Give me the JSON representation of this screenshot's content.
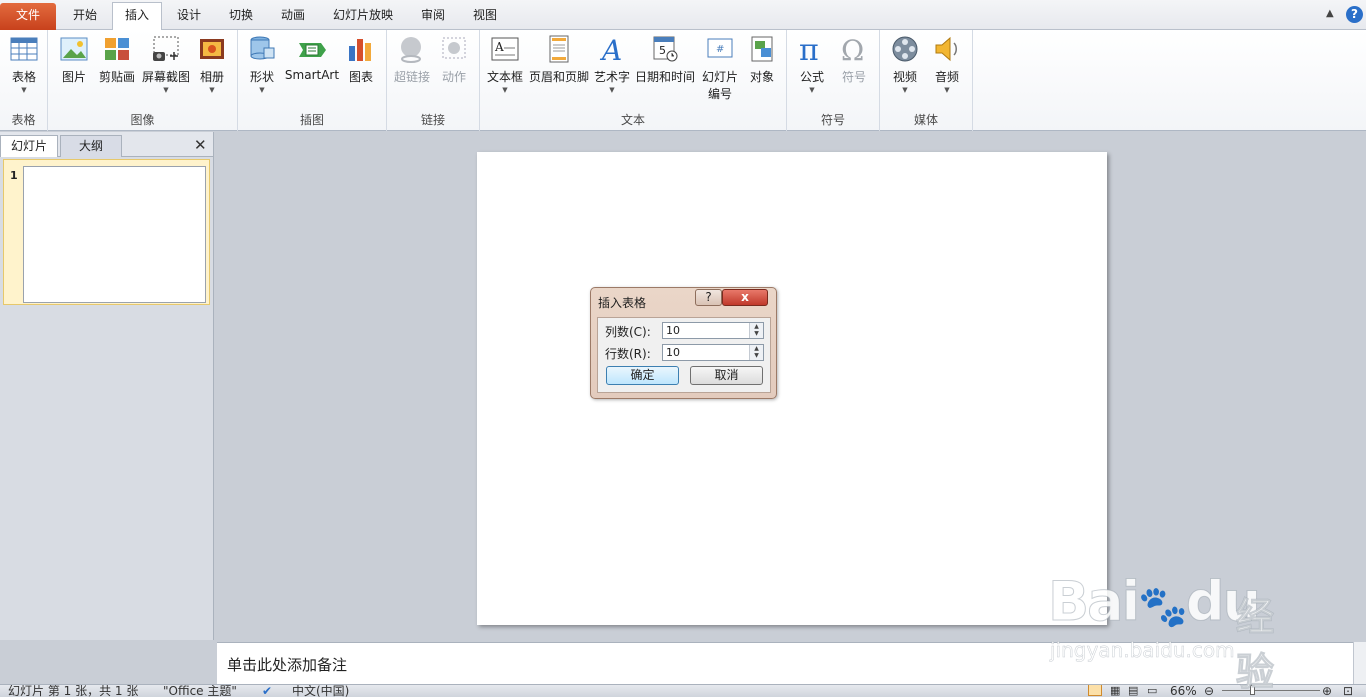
{
  "tabs": [
    "文件",
    "开始",
    "插入",
    "设计",
    "切换",
    "动画",
    "幻灯片放映",
    "审阅",
    "视图"
  ],
  "ribbon": {
    "groups": {
      "table": "表格",
      "image": "图像",
      "illustration": "插图",
      "link": "链接",
      "text": "文本",
      "symbol": "符号",
      "media": "媒体"
    },
    "buttons": {
      "table": "表格",
      "picture": "图片",
      "clipart": "剪贴画",
      "screenshot": "屏幕截图",
      "album": "相册",
      "shape": "形状",
      "smartart": "SmartArt",
      "chart": "图表",
      "hyperlink": "超链接",
      "action": "动作",
      "textbox": "文本框",
      "header_footer": "页眉和页脚",
      "wordart": "艺术字",
      "datetime": "日期和时间",
      "slide_number_1": "幻灯片",
      "slide_number_2": "编号",
      "object": "对象",
      "equation": "公式",
      "symbol": "符号",
      "video": "视频",
      "audio": "音频"
    }
  },
  "left_pane": {
    "tab_slides": "幻灯片",
    "tab_outline": "大纲",
    "slide_number": "1"
  },
  "notes_placeholder": "单击此处添加备注",
  "status": {
    "slide_info": "幻灯片 第 1 张，共 1 张",
    "theme": "\"Office 主题\"",
    "language": "中文(中国)",
    "zoom": "66%"
  },
  "dialog": {
    "title": "插入表格",
    "help": "?",
    "close": "x",
    "columns_label": "列数(C):",
    "columns_value": "10",
    "rows_label": "行数(R):",
    "rows_value": "10",
    "ok": "确定",
    "cancel": "取消"
  },
  "watermark": {
    "brand": "Bai",
    "brand2": "du",
    "cn": "经验",
    "url": "jingyan.baidu.com"
  }
}
